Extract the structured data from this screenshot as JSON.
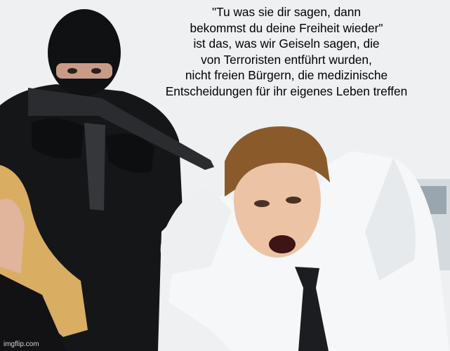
{
  "meme": {
    "caption": "\"Tu was sie dir sagen, dann\nbekommst du deine Freiheit wieder\"\nist das, was wir Geiseln sagen, die\nvon Terroristen entführt wurden,\nnicht freien Bürgern, die medizinische\nEntscheidungen für ihr eigenes Leben treffen",
    "watermark": "imgflip.com"
  },
  "colors": {
    "background": "#eef0f2",
    "caption_text": "#000000",
    "terrorist_clothing": "#151618",
    "shirt": "#f6f7f8",
    "tie": "#1c1d20",
    "hair_brown": "#8a5a2b",
    "hair_blonde": "#d9ad62"
  }
}
